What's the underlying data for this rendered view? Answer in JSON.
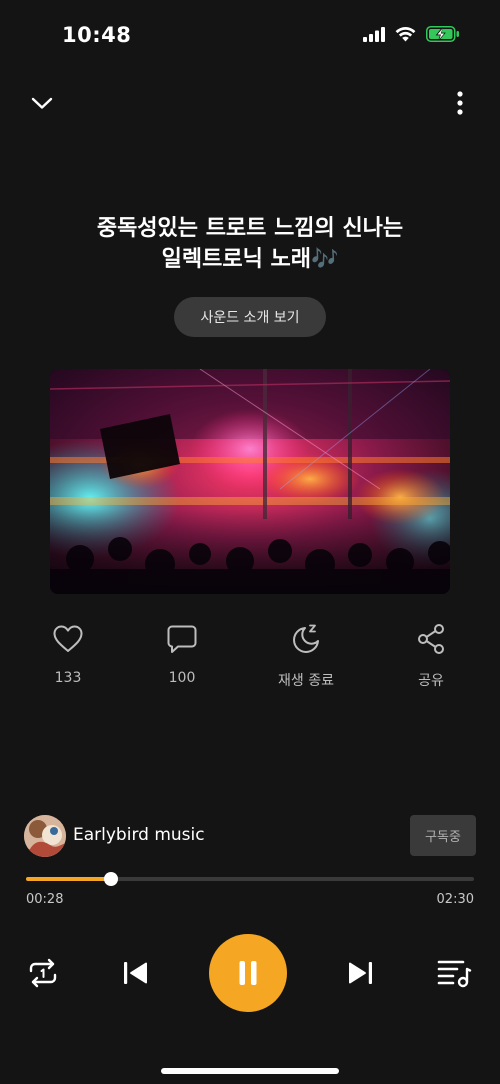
{
  "status": {
    "time": "10:48"
  },
  "track": {
    "title_line1": "중독성있는 트로트 느낌의 신나는",
    "title_line2": "일렉트로닉 노래🎶"
  },
  "sound_intro_label": "사운드 소개 보기",
  "actions": {
    "likes": "133",
    "comments": "100",
    "sleep_timer": "재생 종료",
    "share": "공유"
  },
  "artist": {
    "name": "Earlybird music",
    "subscribe_label": "구독중"
  },
  "playback": {
    "current_time": "00:28",
    "total_time": "02:30",
    "progress": 0.19
  },
  "colors": {
    "accent": "#f5a623",
    "background": "#141414"
  },
  "icons": {
    "top_left": "chevron-down-icon",
    "top_right": "more-vertical-icon",
    "like": "heart-icon",
    "comment": "comment-icon",
    "sleep": "moon-sleep-icon",
    "share": "share-icon",
    "repeat": "repeat-one-icon",
    "prev": "skip-previous-icon",
    "play_state": "pause-icon",
    "next": "skip-next-icon",
    "playlist": "playlist-icon"
  }
}
